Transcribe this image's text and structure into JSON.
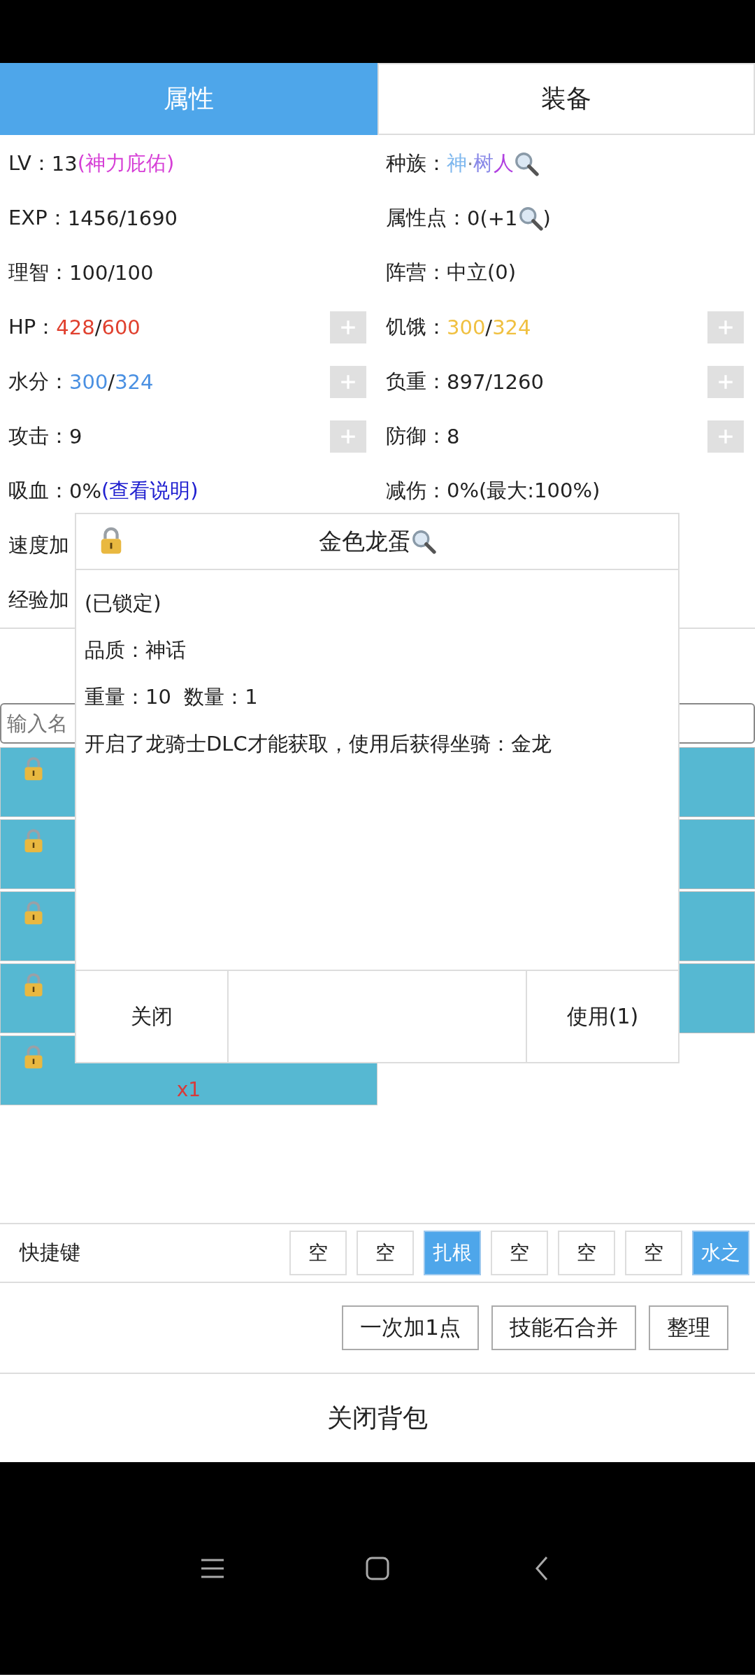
{
  "tabs": [
    {
      "label": "属性",
      "selected": true
    },
    {
      "label": "装备",
      "selected": false
    }
  ],
  "stat_rows": [
    {
      "cells": [
        {
          "label": "LV：",
          "parts": [
            {
              "kind": "text",
              "text": "13"
            },
            {
              "kind": "text",
              "text": "(神力庇佑)",
              "color": "#d63fd6"
            }
          ]
        },
        {
          "label": "种族：",
          "parts": [
            {
              "kind": "text",
              "text": "神",
              "color": "#7fb8ee"
            },
            {
              "kind": "text",
              "text": "·",
              "color": "#888888"
            },
            {
              "kind": "text",
              "text": "树",
              "color": "#8a8ae8"
            },
            {
              "kind": "text",
              "text": "人",
              "color": "#b040e0"
            },
            {
              "kind": "icon"
            }
          ]
        }
      ]
    },
    {
      "cells": [
        {
          "label": "EXP：",
          "parts": [
            {
              "kind": "text",
              "text": "1456/1690"
            }
          ]
        },
        {
          "label": "属性点：",
          "parts": [
            {
              "kind": "text",
              "text": "0(+1"
            },
            {
              "kind": "icon"
            },
            {
              "kind": "text",
              "text": ")"
            }
          ]
        }
      ]
    },
    {
      "cells": [
        {
          "label": "理智：",
          "parts": [
            {
              "kind": "text",
              "text": "100/100"
            }
          ]
        },
        {
          "label": "阵营：",
          "parts": [
            {
              "kind": "text",
              "text": "中立(0)"
            }
          ]
        }
      ]
    },
    {
      "cells": [
        {
          "label": "HP：",
          "plus_button": true,
          "parts": [
            {
              "kind": "text",
              "text": "428",
              "color": "#e0402e"
            },
            {
              "kind": "text",
              "text": "/"
            },
            {
              "kind": "text",
              "text": "600",
              "color": "#e0402e"
            }
          ]
        },
        {
          "label": "饥饿：",
          "plus_button": true,
          "parts": [
            {
              "kind": "text",
              "text": "300",
              "color": "#f0c040"
            },
            {
              "kind": "text",
              "text": "/"
            },
            {
              "kind": "text",
              "text": "324",
              "color": "#f0c040"
            }
          ]
        }
      ]
    },
    {
      "cells": [
        {
          "label": "水分：",
          "plus_button": true,
          "parts": [
            {
              "kind": "text",
              "text": "300",
              "color": "#4a90e2"
            },
            {
              "kind": "text",
              "text": "/"
            },
            {
              "kind": "text",
              "text": "324",
              "color": "#4a90e2"
            }
          ]
        },
        {
          "label": "负重：",
          "plus_button": true,
          "parts": [
            {
              "kind": "text",
              "text": "897/1260"
            }
          ]
        }
      ]
    },
    {
      "cells": [
        {
          "label": "攻击：",
          "plus_button": true,
          "parts": [
            {
              "kind": "text",
              "text": "9"
            }
          ]
        },
        {
          "label": "防御：",
          "plus_button": true,
          "parts": [
            {
              "kind": "text",
              "text": "8"
            }
          ]
        }
      ]
    },
    {
      "cells": [
        {
          "label": "吸血：",
          "parts": [
            {
              "kind": "text",
              "text": "0%"
            },
            {
              "kind": "link",
              "text": "(查看说明)"
            }
          ]
        },
        {
          "label": "减伤：",
          "parts": [
            {
              "kind": "text",
              "text": "0%(最大:100%)"
            }
          ]
        }
      ]
    },
    {
      "cells": [
        {
          "label": "速度加"
        }
      ]
    },
    {
      "cells": [
        {
          "label": "经验加"
        }
      ]
    }
  ],
  "search": {
    "placeholder": "输入名"
  },
  "items": [
    {
      "locked": true
    },
    {
      "locked": false
    },
    {
      "locked": true
    },
    {
      "locked": false
    },
    {
      "locked": true
    },
    {
      "locked": false
    },
    {
      "locked": true
    },
    {
      "locked": false
    },
    {
      "locked": true,
      "count": "x1"
    }
  ],
  "dialog": {
    "locked": true,
    "title": "金色龙蛋",
    "lines": [
      "(已锁定)",
      "品质：神话",
      "重量：10  数量：1",
      "开启了龙骑士DLC才能获取，使用后获得坐骑：金龙"
    ],
    "buttons": [
      "关闭",
      "使用(1)"
    ]
  },
  "quickbar": {
    "label": "快捷键",
    "slots": [
      {
        "label": "空",
        "filled": false
      },
      {
        "label": "空",
        "filled": false
      },
      {
        "label": "扎根",
        "filled": true
      },
      {
        "label": "空",
        "filled": false
      },
      {
        "label": "空",
        "filled": false
      },
      {
        "label": "空",
        "filled": false
      },
      {
        "label": "水之",
        "filled": true
      }
    ]
  },
  "actions": [
    "一次加1点",
    "技能石合并",
    "整理"
  ],
  "close_button": "关闭背包"
}
